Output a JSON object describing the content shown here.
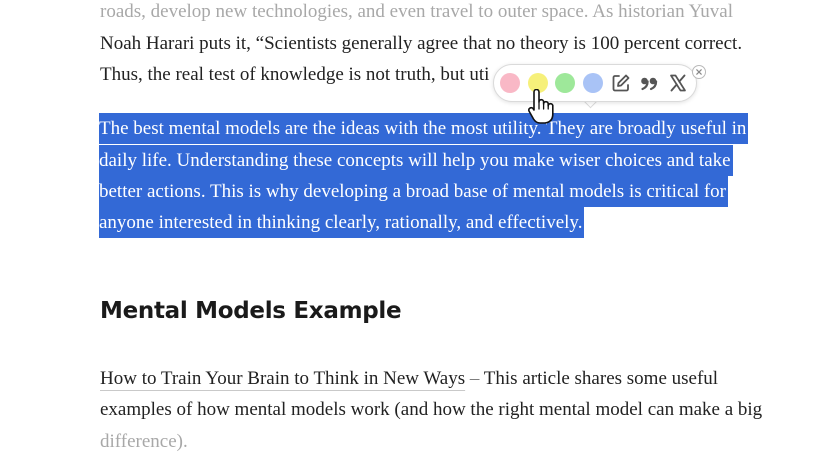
{
  "article": {
    "line_1": "roads, develop new technologies, and even travel to outer space. As historian Yuval",
    "line_2": "Noah Harari puts it, “Scientists generally agree that no theory is 100 percent correct.",
    "line_3": "Thus, the real test of knowledge is not truth, but uti",
    "selected_lines": [
      "The best mental models are the ideas with the most utility. They are broadly useful in",
      "daily life. Understanding these concepts will help you make wiser choices and take",
      "better actions. This is why developing a broad base of mental models is critical for",
      "anyone interested in thinking clearly, rationally, and effectively."
    ],
    "heading": "Mental Models Example",
    "link_text": "How to Train Your Brain to Think in New Ways",
    "dash": "–",
    "after_link": " This article shares some useful",
    "para_line_2": "examples of how mental models work (and how the right mental model can make a big",
    "para_line_3": "difference)."
  },
  "toolbar": {
    "highlight_colors": [
      "#f9b8c6",
      "#f6f07a",
      "#9ee89a",
      "#a9c3f6"
    ],
    "icons": [
      "highlight-pink-icon",
      "highlight-yellow-icon",
      "highlight-green-icon",
      "highlight-blue-icon",
      "note-edit-icon",
      "quote-icon",
      "x-share-icon",
      "close-icon"
    ]
  },
  "colors": {
    "selection": "#3369d6",
    "faded_text": "#a8a8a8"
  }
}
